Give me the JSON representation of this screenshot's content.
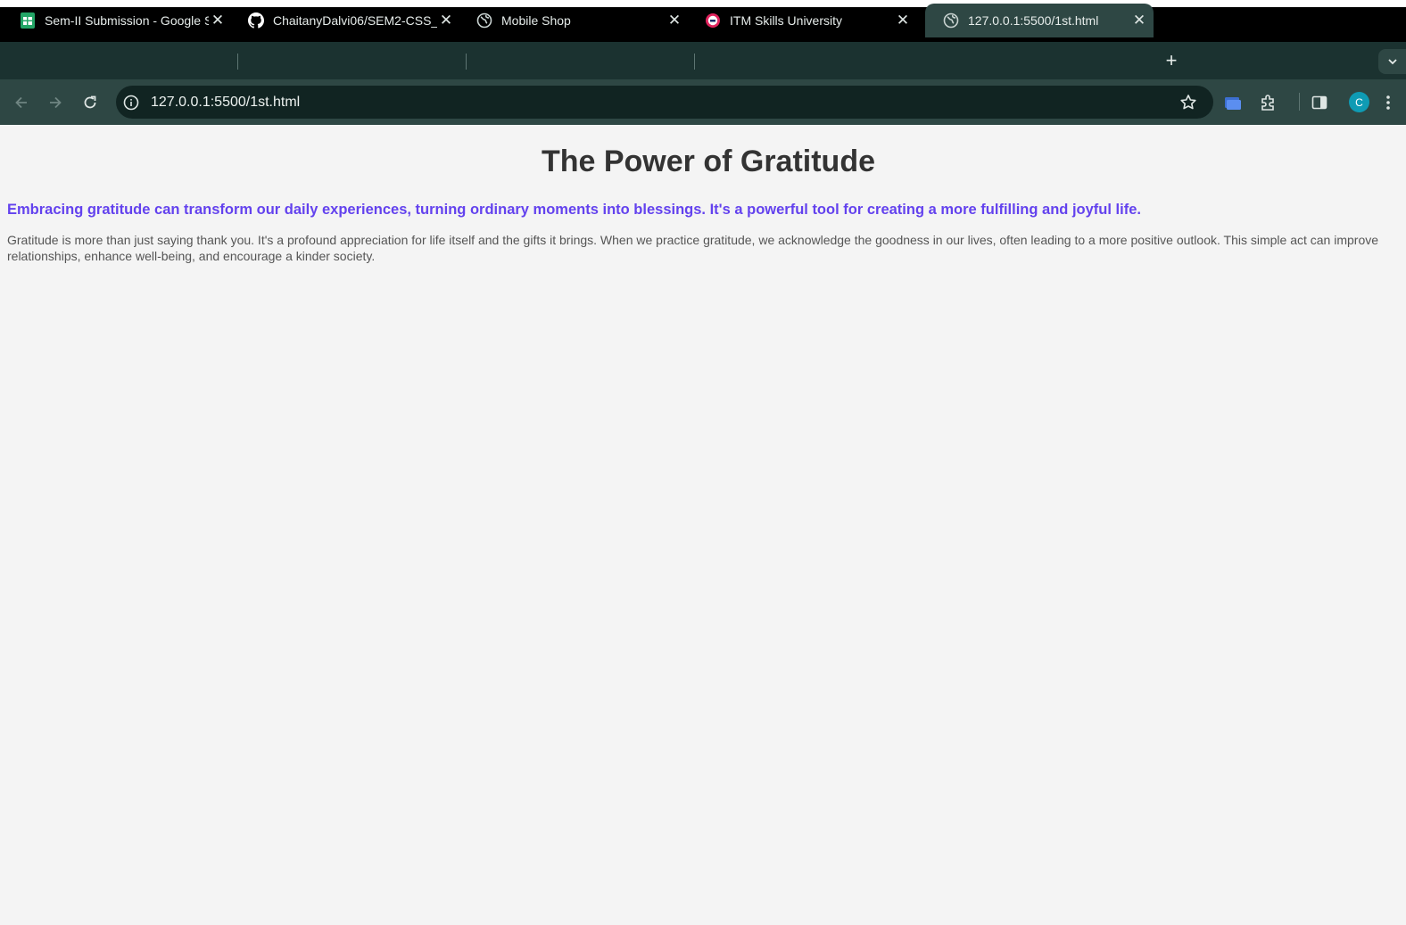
{
  "browser": {
    "tabs": [
      {
        "title": "Sem-II Submission - Google S",
        "icon": "google-sheets-icon"
      },
      {
        "title": "ChaitanyDalvi06/SEM2-CSS_",
        "icon": "github-icon"
      },
      {
        "title": "Mobile Shop",
        "icon": "globe-icon"
      },
      {
        "title": "ITM Skills University",
        "icon": "itm-logo-icon"
      },
      {
        "title": "127.0.0.1:5500/1st.html",
        "icon": "globe-icon",
        "active": true
      }
    ],
    "url": "127.0.0.1:5500/1st.html",
    "profile_initial": "C",
    "colors": {
      "frame": "#1b3230",
      "toolbar": "#2e4744",
      "omnibox": "#112422",
      "avatar": "#0f9bb4"
    }
  },
  "page": {
    "title": "The Power of Gratitude",
    "lead": "Embracing gratitude can transform our daily experiences, turning ordinary moments into blessings. It's a powerful tool for creating a more fulfilling and joyful life.",
    "body": "Gratitude is more than just saying thank you. It's a profound appreciation for life itself and the gifts it brings. When we practice gratitude, we acknowledge the goodness in our lives, often leading to a more positive outlook. This simple act can improve relationships, enhance well-being, and encourage a kinder society.",
    "colors": {
      "title": "#333333",
      "lead": "#6342ee",
      "body": "#555555",
      "background": "#f4f4f4"
    }
  }
}
